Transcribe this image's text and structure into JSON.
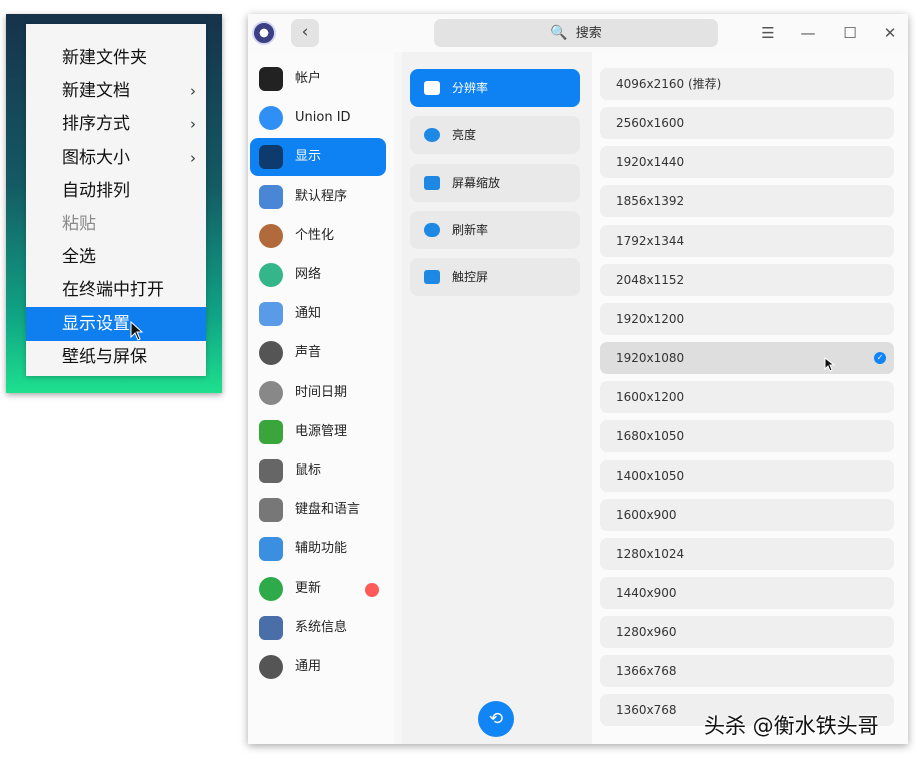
{
  "context_menu": {
    "items": [
      {
        "label": "新建文件夹",
        "submenu": false,
        "state": "normal"
      },
      {
        "label": "新建文档",
        "submenu": true,
        "state": "normal"
      },
      {
        "label": "排序方式",
        "submenu": true,
        "state": "normal"
      },
      {
        "label": "图标大小",
        "submenu": true,
        "state": "normal"
      },
      {
        "label": "自动排列",
        "submenu": false,
        "state": "normal"
      },
      {
        "label": "粘贴",
        "submenu": false,
        "state": "disabled"
      },
      {
        "label": "全选",
        "submenu": false,
        "state": "normal"
      },
      {
        "label": "在终端中打开",
        "submenu": false,
        "state": "normal"
      },
      {
        "label": "显示设置",
        "submenu": false,
        "state": "highlighted"
      },
      {
        "label": "壁纸与屏保",
        "submenu": false,
        "state": "normal"
      }
    ],
    "submenu_arrow": "›"
  },
  "window": {
    "back_label": "‹",
    "search_placeholder": "搜索",
    "search_icon": "🔍",
    "menu_icon": "☰",
    "minimize_icon": "—",
    "maximize_icon": "☐",
    "close_icon": "✕"
  },
  "sidebar": {
    "items": [
      {
        "label": "帐户",
        "icon": "account-icon",
        "color": "#222222",
        "active": false
      },
      {
        "label": "Union ID",
        "icon": "cloud-icon",
        "color": "#2f8ff5",
        "active": false
      },
      {
        "label": "显示",
        "icon": "display-icon",
        "color": "#0d3b6e",
        "active": true
      },
      {
        "label": "默认程序",
        "icon": "default-apps-icon",
        "color": "#4a86d6",
        "active": false
      },
      {
        "label": "个性化",
        "icon": "palette-icon",
        "color": "#b06a3b",
        "active": false
      },
      {
        "label": "网络",
        "icon": "network-icon",
        "color": "#35b58a",
        "active": false
      },
      {
        "label": "通知",
        "icon": "notification-icon",
        "color": "#5a9be8",
        "active": false
      },
      {
        "label": "声音",
        "icon": "sound-icon",
        "color": "#555555",
        "active": false
      },
      {
        "label": "时间日期",
        "icon": "clock-icon",
        "color": "#888888",
        "active": false
      },
      {
        "label": "电源管理",
        "icon": "battery-icon",
        "color": "#3aa53a",
        "active": false
      },
      {
        "label": "鼠标",
        "icon": "mouse-icon",
        "color": "#666666",
        "active": false
      },
      {
        "label": "键盘和语言",
        "icon": "keyboard-icon",
        "color": "#777777",
        "active": false
      },
      {
        "label": "辅助功能",
        "icon": "accessibility-icon",
        "color": "#3a8fe0",
        "active": false
      },
      {
        "label": "更新",
        "icon": "update-icon",
        "color": "#2eaa4a",
        "active": false
      },
      {
        "label": "系统信息",
        "icon": "system-info-icon",
        "color": "#4a6fa8",
        "active": false
      },
      {
        "label": "通用",
        "icon": "general-icon",
        "color": "#555555",
        "active": false
      }
    ],
    "update_badge_color": "#ff5a5a"
  },
  "display_menu": {
    "items": [
      {
        "label": "分辨率",
        "icon": "resolution-icon",
        "color": "#2e7de0",
        "active": true
      },
      {
        "label": "亮度",
        "icon": "brightness-icon",
        "color": "#1e88e5",
        "active": false
      },
      {
        "label": "屏幕缩放",
        "icon": "scale-icon",
        "color": "#1e88e5",
        "active": false
      },
      {
        "label": "刷新率",
        "icon": "refresh-rate-icon",
        "color": "#1e88e5",
        "active": false
      },
      {
        "label": "触控屏",
        "icon": "touchscreen-icon",
        "color": "#1e88e5",
        "active": false
      }
    ],
    "rotate_icon": "⟲"
  },
  "resolutions": {
    "items": [
      "4096x2160 (推荐)",
      "2560x1600",
      "1920x1440",
      "1856x1392",
      "1792x1344",
      "2048x1152",
      "1920x1200",
      "1920x1080",
      "1600x1200",
      "1680x1050",
      "1400x1050",
      "1600x900",
      "1280x1024",
      "1440x900",
      "1280x960",
      "1366x768",
      "1360x768"
    ],
    "selected": "1920x1080",
    "check_icon": "✓"
  },
  "watermark": "头杀 @衡水铁头哥",
  "colors": {
    "accent": "#0f82f3",
    "menu_highlight": "#0f7ff0"
  }
}
